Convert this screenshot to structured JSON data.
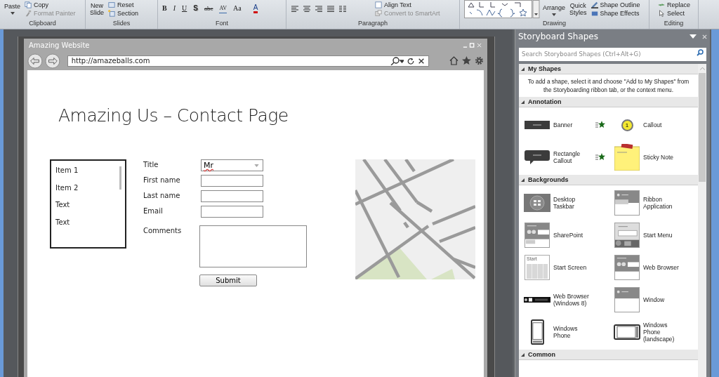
{
  "ribbon": {
    "clipboard": {
      "label": "Clipboard",
      "paste": "Paste",
      "copy": {
        "text": "Copy",
        "disabled": false
      },
      "format_painter": {
        "text": "Format Painter",
        "disabled": true
      }
    },
    "slides": {
      "label": "Slides",
      "new_slide": [
        "New",
        "Slide"
      ],
      "reset": "Reset",
      "section": "Section"
    },
    "font": {
      "label": "Font",
      "buttons": [
        {
          "kind": "bold",
          "text": "B"
        },
        {
          "kind": "italic",
          "text": "I"
        },
        {
          "kind": "underline",
          "text": "U"
        },
        {
          "kind": "shadow",
          "text": "S"
        },
        {
          "kind": "strike",
          "text": "abc"
        },
        {
          "kind": "spacing",
          "text": "AV"
        },
        {
          "kind": "case",
          "text": "Aa"
        },
        {
          "kind": "color",
          "text": "A"
        }
      ]
    },
    "paragraph": {
      "label": "Paragraph",
      "align_text": {
        "text": "Align Text",
        "disabled": false
      },
      "convert": {
        "text": "Convert to SmartArt",
        "disabled": true
      }
    },
    "drawing": {
      "label": "Drawing",
      "arrange": "Arrange",
      "quick_styles": [
        "Quick",
        "Styles"
      ],
      "shape_outline": "Shape Outline",
      "shape_effects": "Shape Effects"
    },
    "editing": {
      "label": "Editing",
      "replace": "Replace",
      "select": "Select"
    }
  },
  "mockup": {
    "title": "Amazing Website",
    "url": "http://amazeballs.com",
    "heading": "Amazing Us – Contact Page",
    "list_items": [
      "Item 1",
      "Item 2",
      "Text",
      "Text"
    ],
    "fields": [
      {
        "label": "Title",
        "kind": "select",
        "value": "Mr"
      },
      {
        "label": "First name",
        "kind": "text"
      },
      {
        "label": "Last name",
        "kind": "text"
      },
      {
        "label": "Email",
        "kind": "text"
      },
      {
        "label": "Comments",
        "kind": "textarea"
      }
    ],
    "submit": "Submit"
  },
  "pane": {
    "title": "Storyboard Shapes",
    "search": {
      "placeholder": "Search Storyboard Shapes (Ctrl+Alt+G)"
    },
    "sections": [
      {
        "title": "My Shapes",
        "expanded": true,
        "description": "To add a shape, select it and choose \"Add to My Shapes\" from the Storyboarding ribbon tab, or the context menu."
      },
      {
        "title": "Annotation",
        "expanded": true,
        "shapes": [
          {
            "label": "Banner",
            "starred": true
          },
          {
            "label": "Callout",
            "icon_text": "1",
            "starred": false
          },
          {
            "label": "Rectangle Callout",
            "starred": true
          },
          {
            "label": "Sticky Note",
            "starred": false
          }
        ]
      },
      {
        "title": "Backgrounds",
        "expanded": true,
        "shapes": [
          {
            "label": "Desktop Taskbar",
            "starred": false
          },
          {
            "label": "Ribbon Application",
            "starred": false
          },
          {
            "label": "SharePoint",
            "starred": false
          },
          {
            "label": "Start Menu",
            "starred": false
          },
          {
            "label": "Start Screen",
            "icon_text": "Start",
            "starred": false
          },
          {
            "label": "Web Browser",
            "starred": false
          },
          {
            "label": "Web Browser (Windows 8)",
            "starred": false
          },
          {
            "label": "Window",
            "starred": false
          },
          {
            "label": "Windows Phone",
            "starred": false
          },
          {
            "label": "Windows Phone (landscape)",
            "starred": false
          }
        ]
      },
      {
        "title": "Common",
        "expanded": true
      }
    ]
  }
}
